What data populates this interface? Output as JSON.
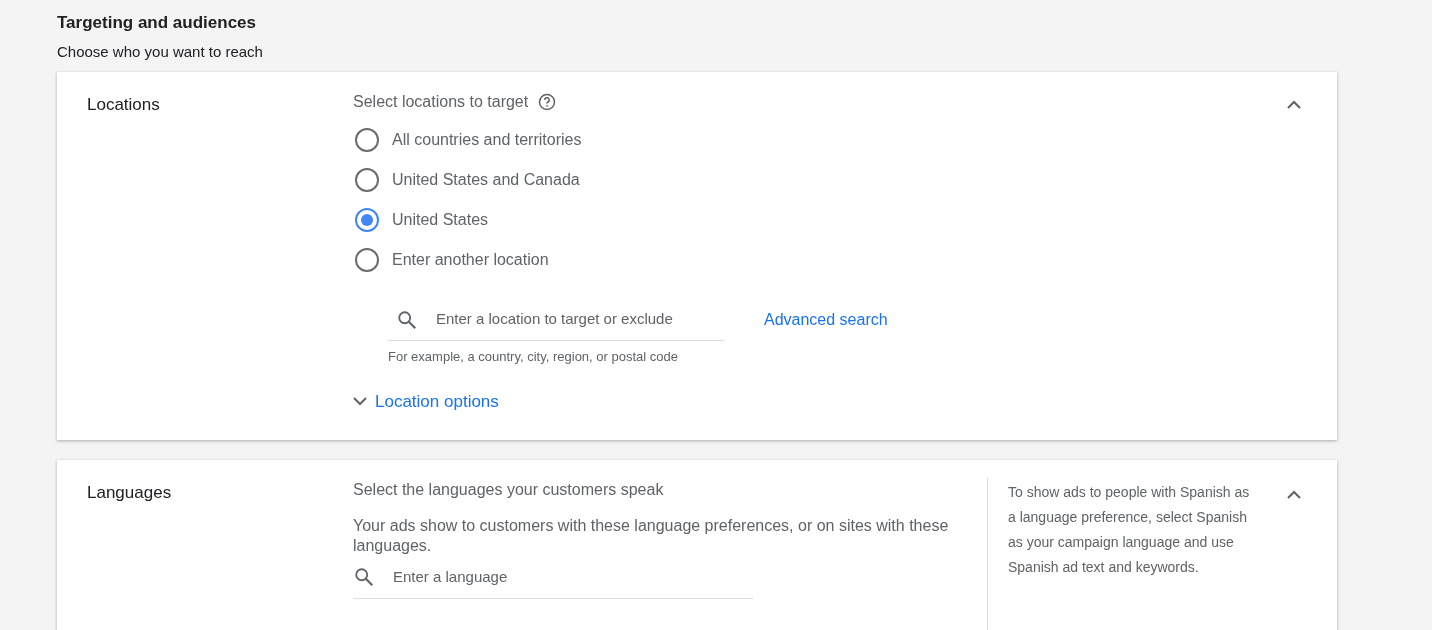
{
  "header": {
    "title": "Targeting and audiences",
    "subtitle": "Choose who you want to reach"
  },
  "locations": {
    "label": "Locations",
    "expanded": true,
    "prompt": "Select locations to target",
    "options": [
      {
        "label": "All countries and territories",
        "selected": false
      },
      {
        "label": "United States and Canada",
        "selected": false
      },
      {
        "label": "United States",
        "selected": true
      },
      {
        "label": "Enter another location",
        "selected": false
      }
    ],
    "search": {
      "placeholder": "Enter a location to target or exclude",
      "hint": "For example, a country, city, region, or postal code"
    },
    "advanced_search": "Advanced search",
    "location_options": {
      "label": "Location options",
      "expanded": false
    }
  },
  "languages": {
    "label": "Languages",
    "expanded": true,
    "prompt": "Select the languages your customers speak",
    "description": "Your ads show to customers with these language preferences, or on sites with these languages.",
    "search": {
      "placeholder": "Enter a language"
    },
    "tip": "To show ads to people with Spanish as a language preference, select Spanish as your campaign language and use Spanish ad text and keywords."
  }
}
